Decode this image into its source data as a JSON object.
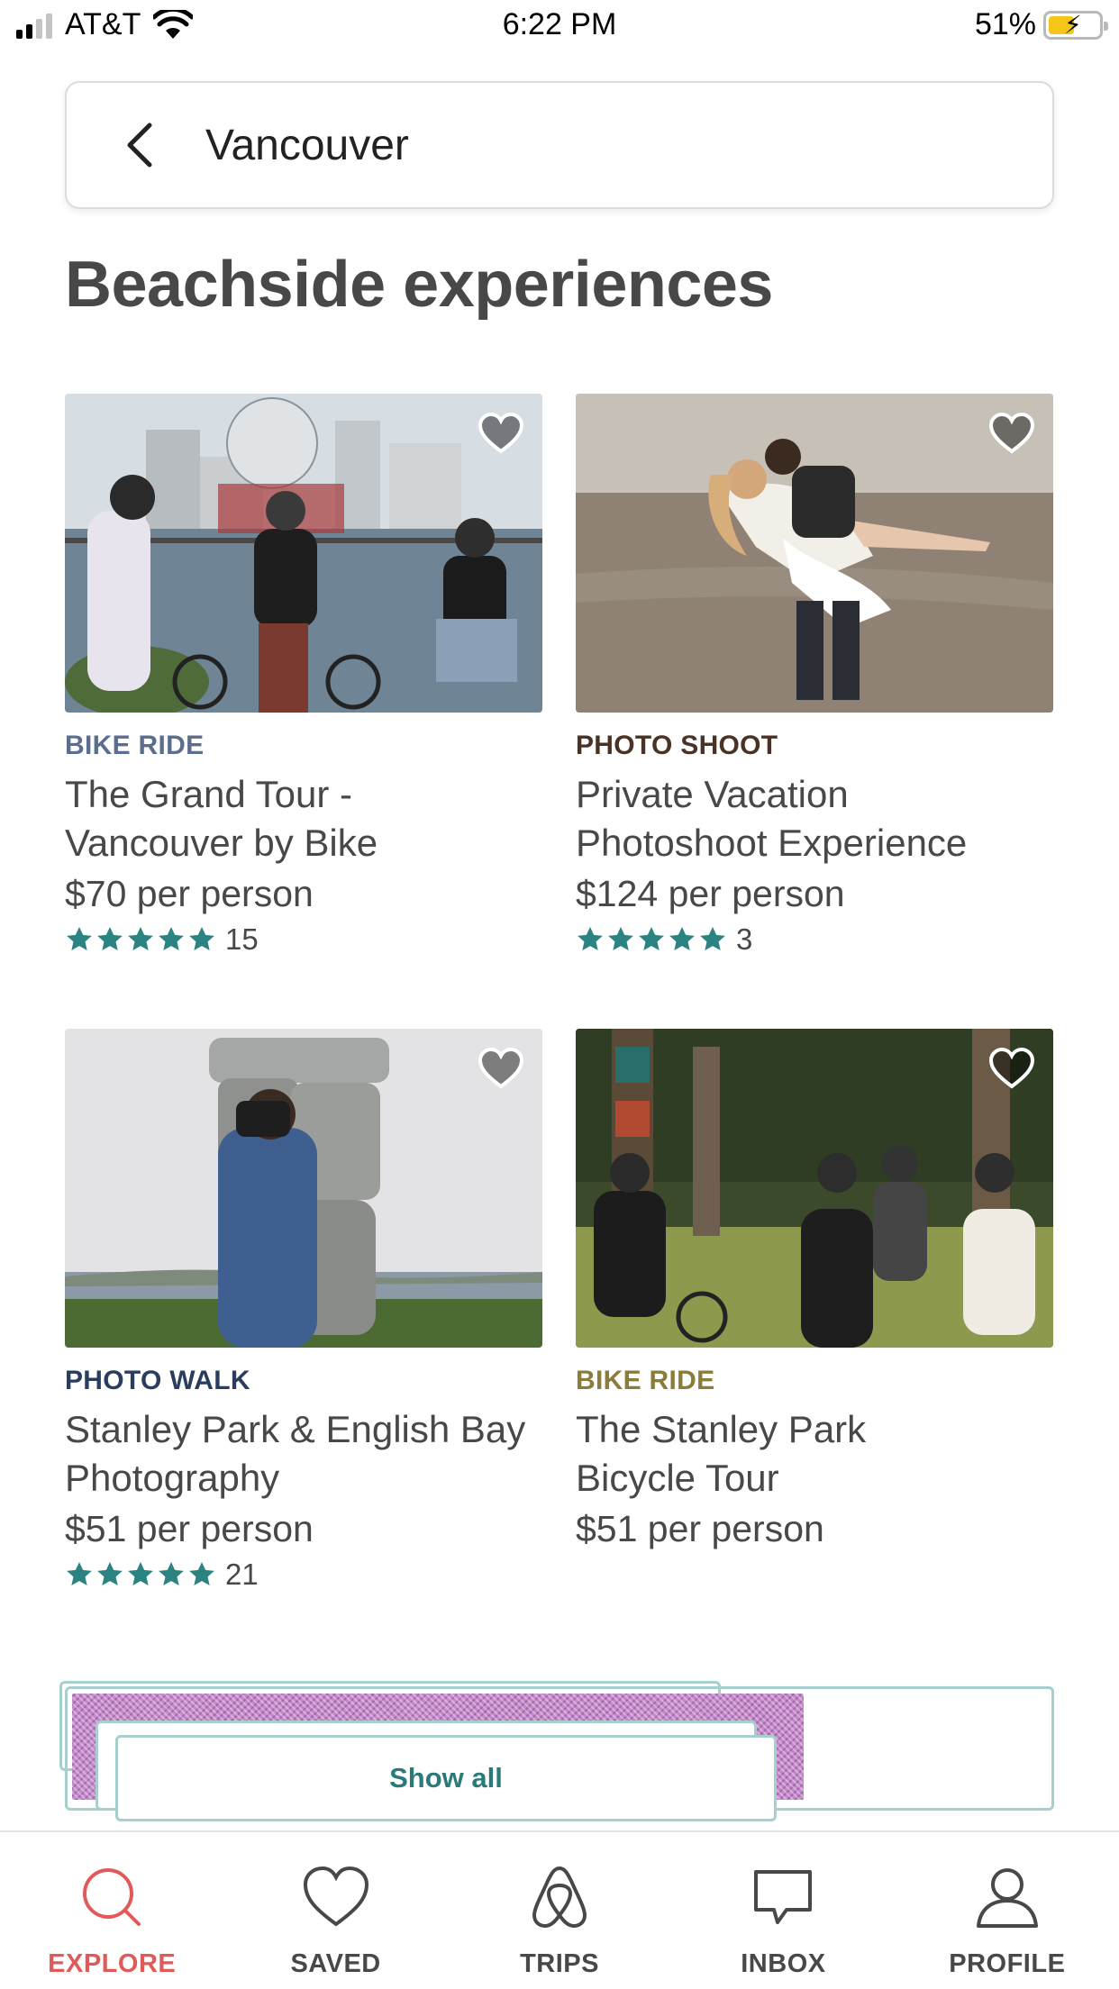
{
  "status_bar": {
    "carrier": "AT&T",
    "time": "6:22 PM",
    "battery_percent": "51%",
    "battery_level": 0.51,
    "signal_bars": 2
  },
  "search": {
    "location": "Vancouver",
    "back_icon": "chevron-left-icon"
  },
  "section": {
    "title": "Beachside experiences"
  },
  "colors": {
    "star": "#2b8382",
    "active_tab": "#e05a5a",
    "show_all": "#2a7a7a",
    "category_bike_ride_1": "#5c6e8e",
    "category_photo_shoot": "#4a3326",
    "category_photo_walk": "#2a3d5e",
    "category_bike_ride_2": "#8a7c3a"
  },
  "cards": [
    {
      "category": "BIKE RIDE",
      "category_color": "#5c6e8e",
      "title_line1": "The Grand Tour -",
      "title_line2": "Vancouver by Bike",
      "price": "$70 per person",
      "rating_stars": 5,
      "reviews": "15",
      "image": "cyclists-by-science-world"
    },
    {
      "category": "PHOTO SHOOT",
      "category_color": "#4a3326",
      "title_line1": "Private Vacation",
      "title_line2": "Photoshoot Experience",
      "price": "$124 per person",
      "rating_stars": 5,
      "reviews": "3",
      "image": "couple-kissing-in-water"
    },
    {
      "category": "PHOTO WALK",
      "category_color": "#2a3d5e",
      "title_line1": "Stanley Park & English Bay",
      "title_line2": "Photography",
      "price": "$51 per person",
      "rating_stars": 5,
      "reviews": "21",
      "image": "photographer-at-inukshuk"
    },
    {
      "category": "BIKE RIDE",
      "category_color": "#8a7c3a",
      "title_line1": "The Stanley Park",
      "title_line2": "Bicycle Tour",
      "price": "$51 per person",
      "image": "cyclists-at-totem-poles"
    }
  ],
  "show_all": {
    "label": "Show all"
  },
  "tabs": [
    {
      "label": "EXPLORE",
      "icon": "search-icon",
      "active": true
    },
    {
      "label": "SAVED",
      "icon": "heart-icon",
      "active": false
    },
    {
      "label": "TRIPS",
      "icon": "airbnb-logo-icon",
      "active": false
    },
    {
      "label": "INBOX",
      "icon": "message-icon",
      "active": false
    },
    {
      "label": "PROFILE",
      "icon": "user-icon",
      "active": false
    }
  ]
}
